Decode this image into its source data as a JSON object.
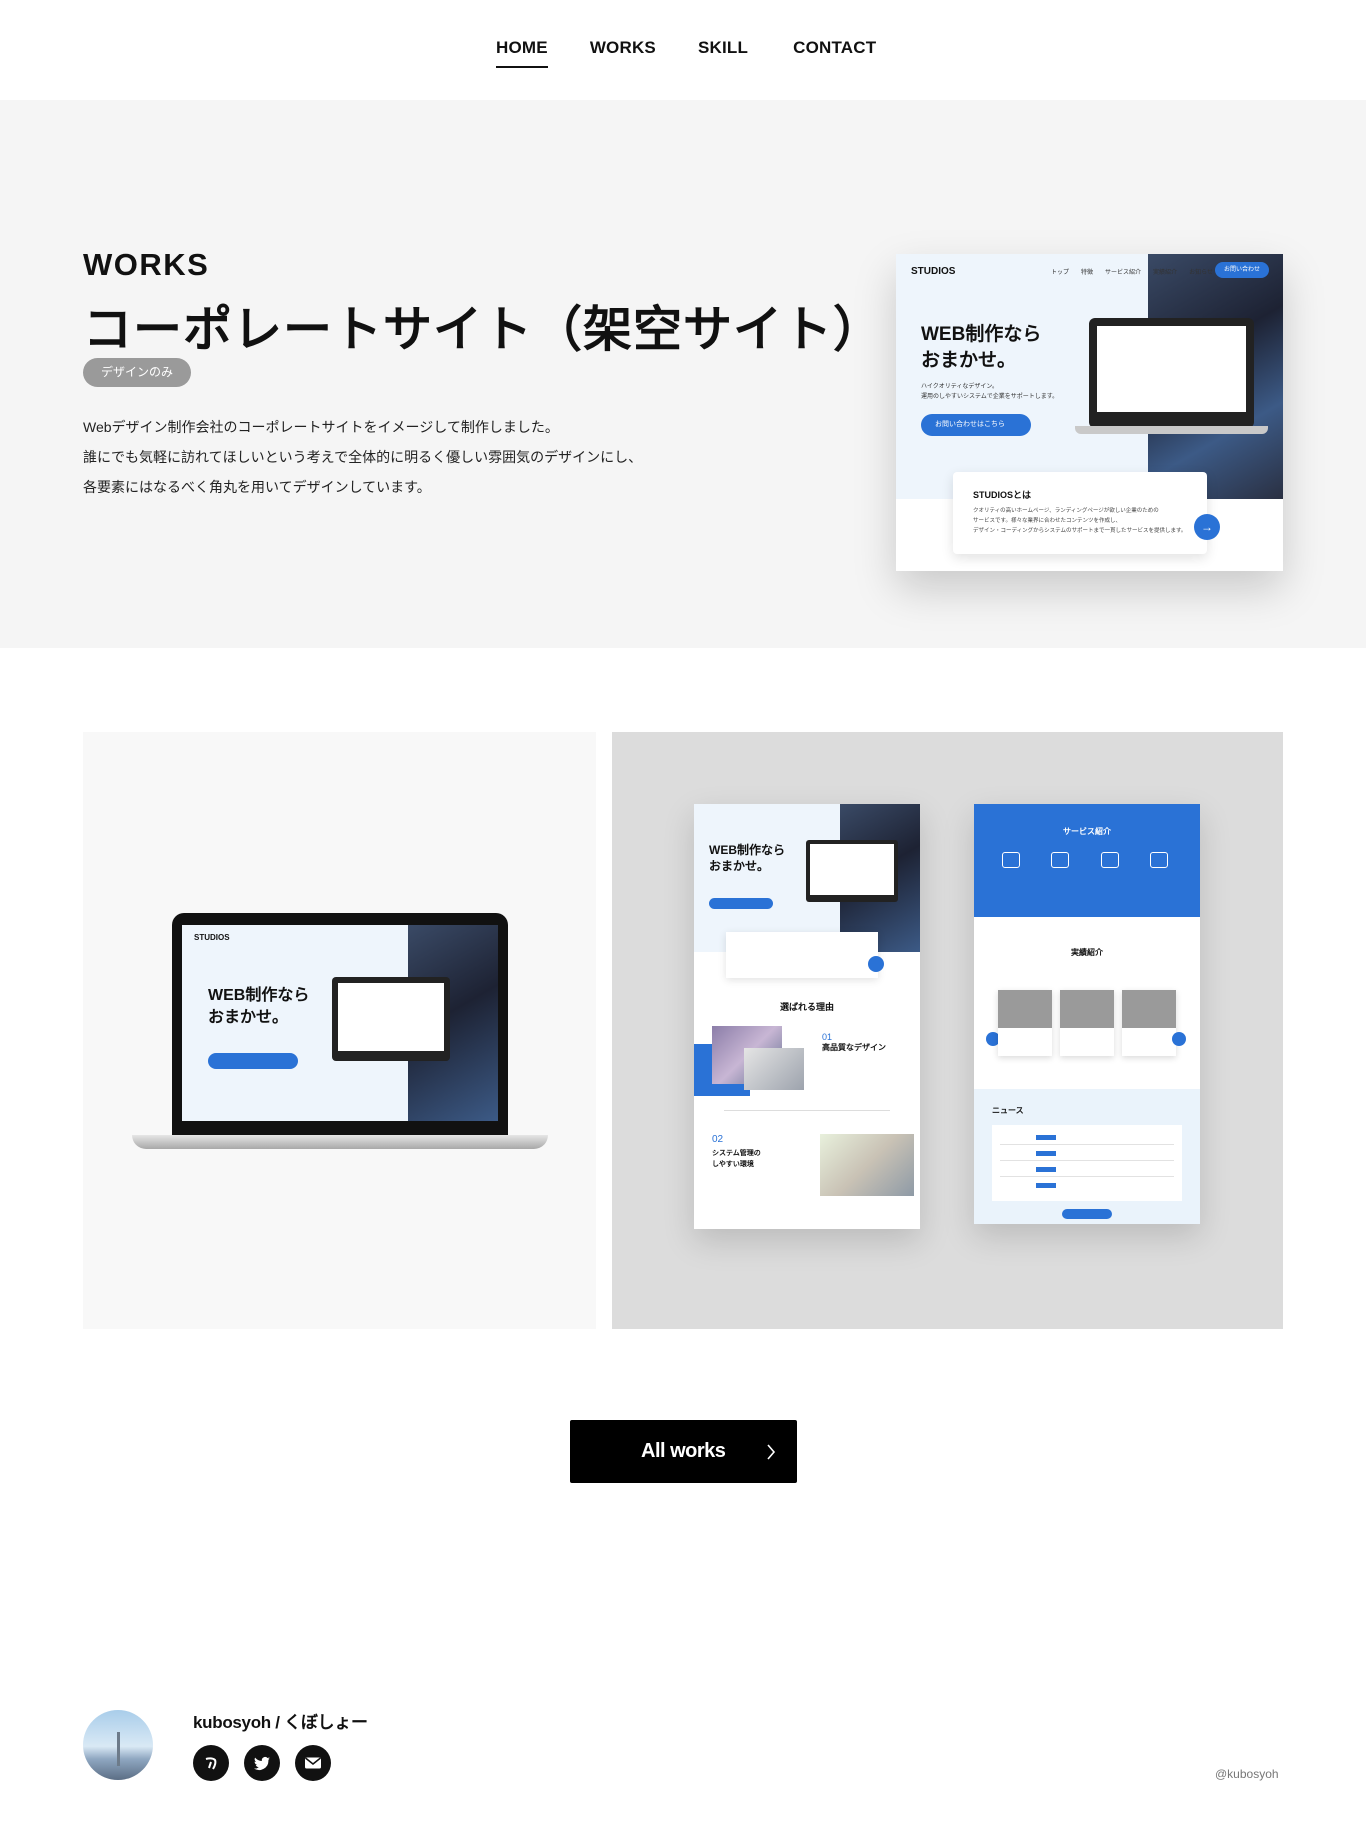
{
  "nav": {
    "items": [
      {
        "label": "HOME",
        "active": true
      },
      {
        "label": "WORKS",
        "active": false
      },
      {
        "label": "SKILL",
        "active": false
      },
      {
        "label": "CONTACT",
        "active": false
      }
    ]
  },
  "hero": {
    "section_label": "WORKS",
    "title": "コーポレートサイト（架空サイト）",
    "tag": "デザインのみ",
    "description": [
      "Webデザイン制作会社のコーポレートサイトをイメージして制作しました。",
      "誰にでも気軽に訪れてほしいという考えで全体的に明るく優しい雰囲気のデザインにし、",
      "各要素にはなるべく角丸を用いてデザインしています。"
    ],
    "mockup": {
      "brand": "STUDIOS",
      "nav": [
        "トップ",
        "特徴",
        "サービス紹介",
        "実績紹介",
        "お知らせ"
      ],
      "cta": "お問い合わせ",
      "headline_1": "WEB制作なら",
      "headline_2": "おまかせ。",
      "sub_1": "ハイクオリティなデザイン。",
      "sub_2": "運用のしやすいシステムで企業をサポートします。",
      "button": "お問い合わせはこちら",
      "card_title": "STUDIOSとは",
      "card_lines": [
        "クオリティの高いホームページ、ランディングページが欲しい企業のための",
        "サービスです。様々な業界に合わせたコンテンツを作成し、",
        "デザイン・コーディングからシステムのサポートまで一貫したサービスを提供します。"
      ]
    }
  },
  "gallery": {
    "macbook_headline_1": "WEB制作なら",
    "macbook_headline_2": "おまかせ。",
    "macbook_brand": "STUDIOS",
    "page_a": {
      "headline_1": "WEB制作なら",
      "headline_2": "おまかせ。",
      "reason_title": "選ばれる理由",
      "point_1_num": "01",
      "point_1_title": "高品質なデザイン",
      "point_2_num": "02",
      "point_2_title_1": "システム管理の",
      "point_2_title_2": "しやすい環境"
    },
    "page_b": {
      "service_title": "サービス紹介",
      "works_title": "実績紹介",
      "news_title": "ニュース"
    }
  },
  "cta": {
    "all_works_label": "All works"
  },
  "footer": {
    "author": "kubosyoh / くぼしょー",
    "handle": "@kubosyoh",
    "social": [
      "note-icon",
      "twitter-icon",
      "mail-icon"
    ]
  },
  "colors": {
    "accent_blue": "#2a72d6",
    "hero_bg": "#f5f5f5",
    "button_black": "#000000",
    "tag_gray": "#9a9a9a"
  }
}
